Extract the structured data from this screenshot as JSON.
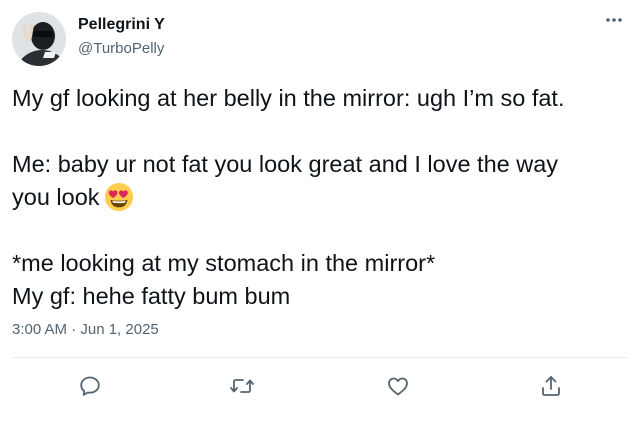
{
  "user": {
    "display_name": "Pellegrini Y",
    "handle": "@TurboPelly",
    "avatar_icon": "avatar-image"
  },
  "menu": {
    "more_icon": "more-options-icon"
  },
  "tweet": {
    "line1": "My gf looking at her belly in the mirror: ugh I’m so fat.",
    "line2": "Me: baby ur not fat you look great and I love the way",
    "line3": "you look",
    "line3_emoji": "heart-eyes-emoji",
    "line4": "*me looking at my stomach in the mirror*",
    "line5": "My gf: hehe fatty bum bum"
  },
  "timestamp": "3:00 AM · Jun 1, 2025",
  "actions": [
    {
      "name": "reply",
      "icon": "reply-icon"
    },
    {
      "name": "retweet",
      "icon": "retweet-icon"
    },
    {
      "name": "like",
      "icon": "heart-icon"
    },
    {
      "name": "share",
      "icon": "share-icon"
    }
  ],
  "colors": {
    "text": "#0f1419",
    "secondary": "#536471",
    "divider": "#e7e9ea",
    "icon": "#536471"
  }
}
